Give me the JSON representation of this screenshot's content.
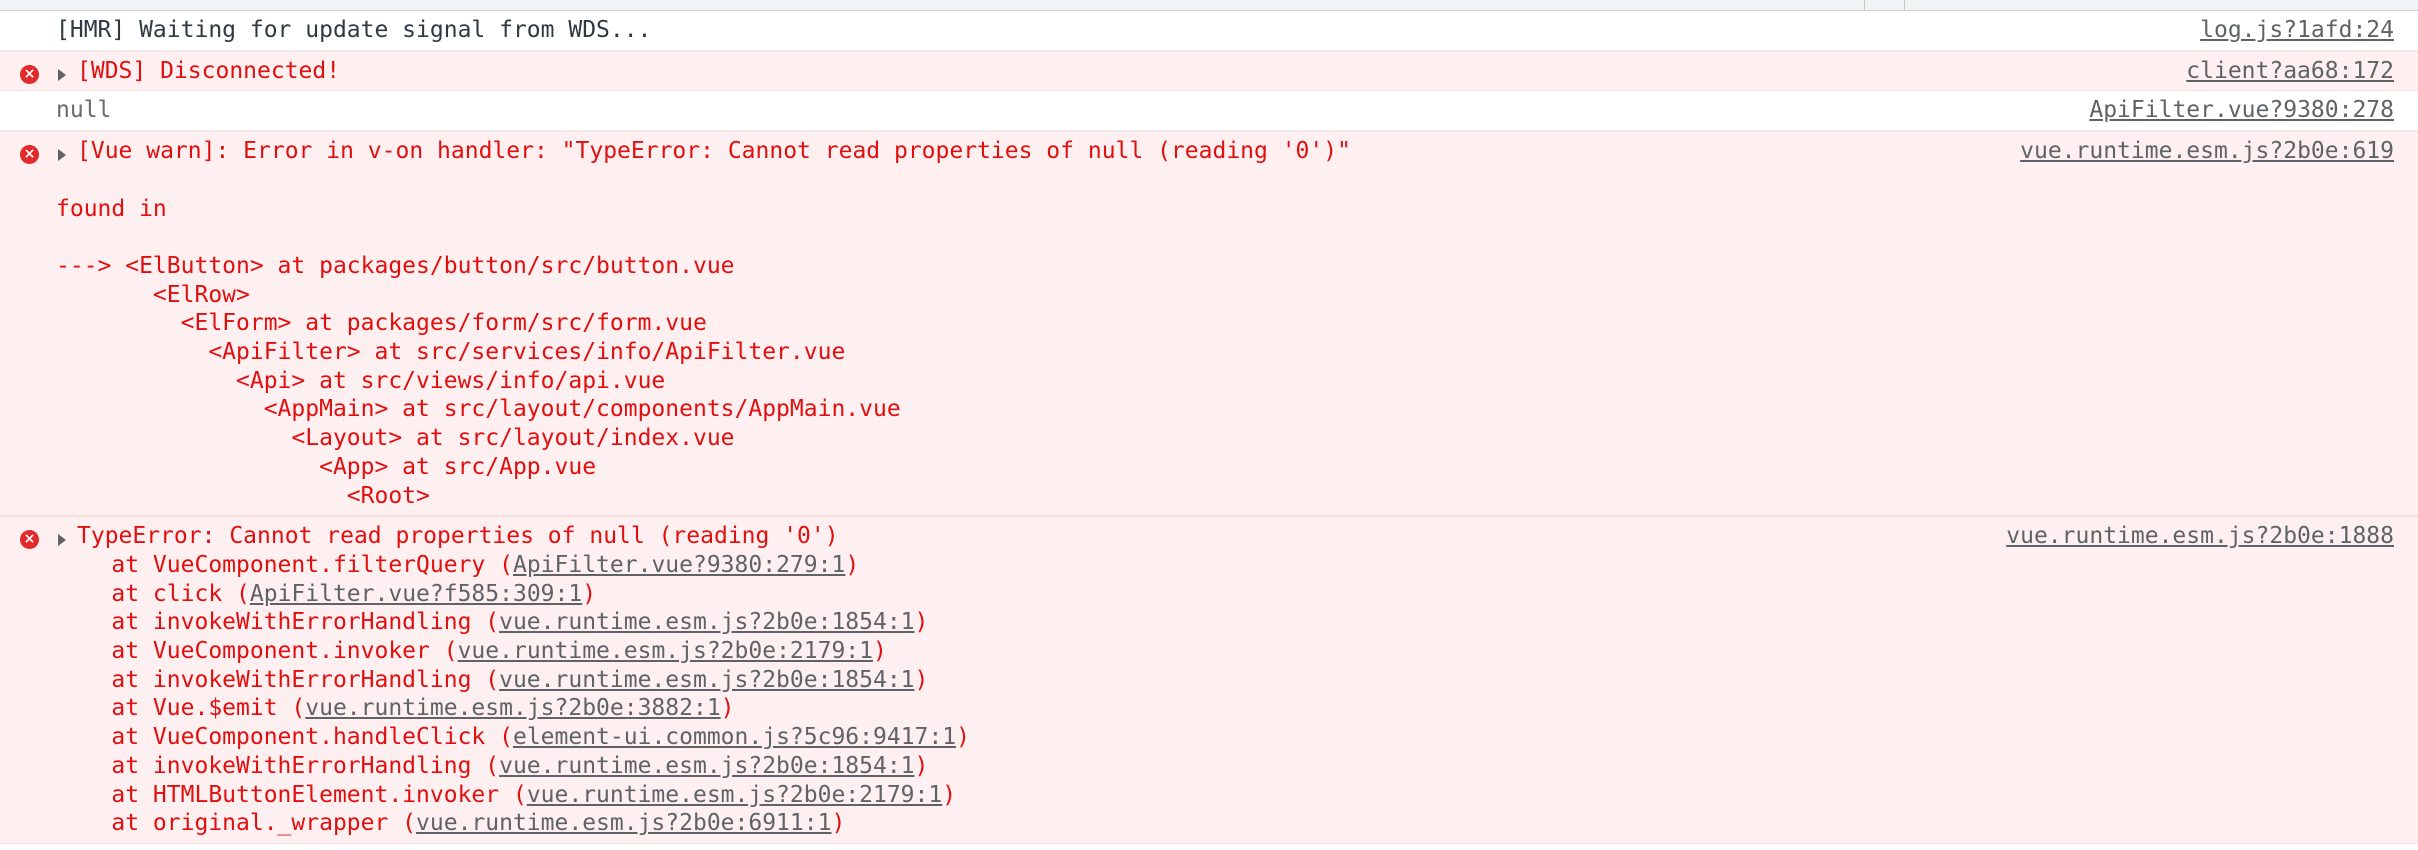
{
  "messages": {
    "hmr": {
      "text": "[HMR] Waiting for update signal from WDS...",
      "source": "log.js?1afd:24"
    },
    "wds": {
      "text": "[WDS] Disconnected!",
      "source": "client?aa68:172"
    },
    "null_log": {
      "text": "null",
      "source": "ApiFilter.vue?9380:278"
    },
    "vue_warn": {
      "text": "[Vue warn]: Error in v-on handler: \"TypeError: Cannot read properties of null (reading '0')\"",
      "source": "vue.runtime.esm.js?2b0e:619",
      "found_in": "found in",
      "tree": [
        "---> <ElButton> at packages/button/src/button.vue",
        "       <ElRow>",
        "         <ElForm> at packages/form/src/form.vue",
        "           <ApiFilter> at src/services/info/ApiFilter.vue",
        "             <Api> at src/views/info/api.vue",
        "               <AppMain> at src/layout/components/AppMain.vue",
        "                 <Layout> at src/layout/index.vue",
        "                   <App> at src/App.vue",
        "                     <Root>"
      ]
    },
    "type_error": {
      "text": "TypeError: Cannot read properties of null (reading '0')",
      "source": "vue.runtime.esm.js?2b0e:1888",
      "trace": [
        {
          "prefix": "    at VueComponent.filterQuery (",
          "link": "ApiFilter.vue?9380:279:1",
          "suffix": ")"
        },
        {
          "prefix": "    at click (",
          "link": "ApiFilter.vue?f585:309:1",
          "suffix": ")"
        },
        {
          "prefix": "    at invokeWithErrorHandling (",
          "link": "vue.runtime.esm.js?2b0e:1854:1",
          "suffix": ")"
        },
        {
          "prefix": "    at VueComponent.invoker (",
          "link": "vue.runtime.esm.js?2b0e:2179:1",
          "suffix": ")"
        },
        {
          "prefix": "    at invokeWithErrorHandling (",
          "link": "vue.runtime.esm.js?2b0e:1854:1",
          "suffix": ")"
        },
        {
          "prefix": "    at Vue.$emit (",
          "link": "vue.runtime.esm.js?2b0e:3882:1",
          "suffix": ")"
        },
        {
          "prefix": "    at VueComponent.handleClick (",
          "link": "element-ui.common.js?5c96:9417:1",
          "suffix": ")"
        },
        {
          "prefix": "    at invokeWithErrorHandling (",
          "link": "vue.runtime.esm.js?2b0e:1854:1",
          "suffix": ")"
        },
        {
          "prefix": "    at HTMLButtonElement.invoker (",
          "link": "vue.runtime.esm.js?2b0e:2179:1",
          "suffix": ")"
        },
        {
          "prefix": "    at original._wrapper (",
          "link": "vue.runtime.esm.js?2b0e:6911:1",
          "suffix": ")"
        }
      ]
    }
  },
  "icons": {
    "error_glyph": "×"
  },
  "colors": {
    "error_text": "#e10f0f",
    "error_bg": "#fef0f0",
    "error_icon": "#e12a2a"
  }
}
